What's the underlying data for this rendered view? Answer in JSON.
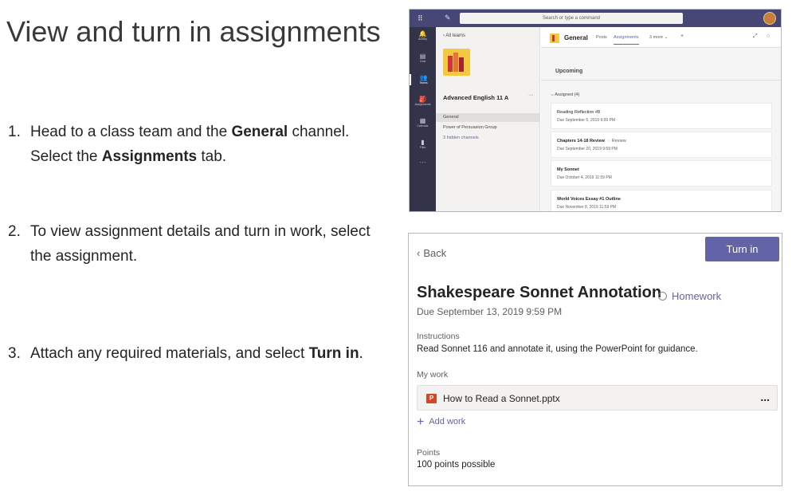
{
  "instructions": {
    "title": "View and turn in assignments",
    "steps": [
      {
        "num": "1.",
        "parts": [
          "Head to a class team and the ",
          "General",
          " channel. Select the ",
          "Assignments",
          " tab."
        ]
      },
      {
        "num": "2.",
        "text": "To view assignment details and turn in work, select the assignment."
      },
      {
        "num": "3.",
        "parts": [
          "Attach any required materials, and select ",
          "Turn in",
          "."
        ]
      }
    ]
  },
  "teams": {
    "search_placeholder": "Search or type a command",
    "rail": [
      {
        "icon": "bell-icon",
        "glyph": "🔔",
        "label": "Activity"
      },
      {
        "icon": "chat-icon",
        "glyph": "▤",
        "label": "Chat"
      },
      {
        "icon": "teams-icon",
        "glyph": "👥",
        "label": "Teams"
      },
      {
        "icon": "assignments-icon",
        "glyph": "🎒",
        "label": "Assignments"
      },
      {
        "icon": "calendar-icon",
        "glyph": "▦",
        "label": "Calendar"
      },
      {
        "icon": "files-icon",
        "glyph": "▮",
        "label": "Files"
      },
      {
        "icon": "more-icon",
        "glyph": "···",
        "label": ""
      }
    ],
    "all_teams": "All teams",
    "class_name": "Advanced English 11 A",
    "channels": [
      "General",
      "Power of Persuasion Group",
      "3 hidden channels"
    ],
    "header": {
      "title": "General",
      "tabs": [
        "Posts",
        "Assignments",
        "3 more"
      ]
    },
    "upcoming": "Upcoming",
    "assigned_header": "Assigned (4)",
    "assignments": [
      {
        "title": "Reading Reflection #8",
        "due": "Due September 5, 2019 9:59 PM",
        "bold": false,
        "tag": ""
      },
      {
        "title": "Chapters 14-18 Review",
        "due": "Due September 20, 2019 9:59 PM",
        "bold": true,
        "tag": "Review"
      },
      {
        "title": "My Sonnet",
        "due": "Due October 4, 2019 11:59 PM",
        "bold": true,
        "tag": ""
      },
      {
        "title": "World Voices Essay #1 Outline",
        "due": "Due November 8, 2019 11:59 PM",
        "bold": true,
        "tag": ""
      }
    ]
  },
  "details": {
    "back_label": "Back",
    "turn_in_label": "Turn in",
    "title": "Shakespeare Sonnet Annotation",
    "category": "Homework",
    "due": "Due September 13, 2019 9:59 PM",
    "instructions_label": "Instructions",
    "instructions_text": "Read Sonnet 116 and annotate it, using the PowerPoint for guidance.",
    "my_work_label": "My work",
    "file_name": "How to Read a Sonnet.pptx",
    "file_more": "...",
    "add_work_label": "Add work",
    "points_label": "Points",
    "points_value": "100 points possible"
  },
  "colors": {
    "brand": "#6264a7",
    "teams_bar": "#464775",
    "rail": "#33344a",
    "ppt": "#d24726"
  }
}
